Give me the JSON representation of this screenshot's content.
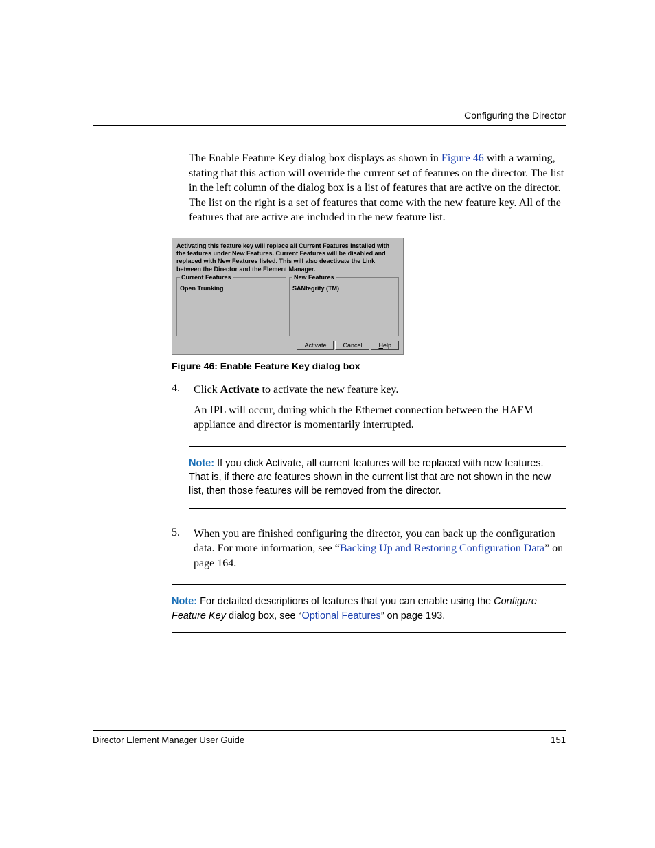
{
  "running_head": "Configuring the Director",
  "intro": {
    "text_before_link": "The Enable Feature Key dialog box displays as shown in ",
    "link": "Figure 46",
    "text_after_link": " with a warning, stating that this action will override the current set of features on the director. The list in the left column of the dialog box is a list of features that are active on the director. The list on the right is a set of features that come with the new feature key. All of the features that are active are included in the new feature list."
  },
  "dialog": {
    "warn": "Activating this feature key will replace all Current Features installed with the features under  New Features.  Current Features will be disabled and replaced with New Features listed. This will also deactivate the Link between the Director and the Element Manager.",
    "current_label": "Current Features",
    "current_item": "Open Trunking",
    "new_label": "New Features",
    "new_item": "SANtegrity (TM)",
    "btn_activate": "Activate",
    "btn_cancel": "Cancel",
    "btn_help_u": "H",
    "btn_help_rest": "elp"
  },
  "figure_caption": "Figure 46:  Enable Feature Key dialog box",
  "step4": {
    "num": "4.",
    "before_bold": "Click ",
    "bold": "Activate",
    "after_bold": " to activate the new feature key.",
    "sub": "An IPL will occur, during which the Ethernet connection between the HAFM appliance and director is momentarily interrupted."
  },
  "note1": {
    "label": "Note:",
    "text": "  If you click Activate, all current features will be replaced with new features. That is, if there are features shown in the current list that are not shown in the new list, then those features will be removed from the director."
  },
  "step5": {
    "num": "5.",
    "text_before_link": "When you are finished configuring the director, you can back up the configuration data. For more information, see “",
    "link": "Backing Up and Restoring Configuration Data",
    "text_after_link": "” on page 164."
  },
  "note2": {
    "label": "Note:",
    "text_before_italic": "  For detailed descriptions of features that you can enable using the ",
    "italic": "Configure Feature Key",
    "text_mid": " dialog box, see “",
    "link": "Optional Features",
    "text_after_link": "” on page 193."
  },
  "footer": {
    "left": "Director Element Manager User Guide",
    "right": "151"
  }
}
